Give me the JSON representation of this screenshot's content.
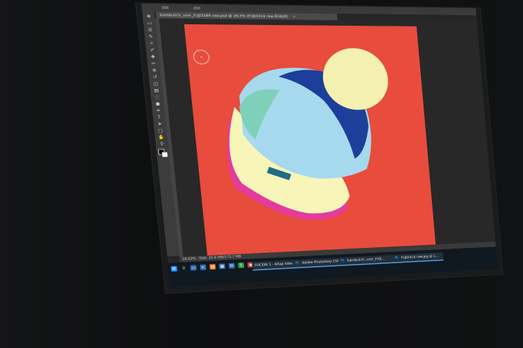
{
  "photoshop": {
    "document_tab": "bambulich_vzor_FUJI3189 raw.psd @ 26,5% (FUJI0419 raw,RGB/8)",
    "tab_close": "×",
    "ruler_top": [
      "300",
      "200"
    ],
    "status_zoom": "26,52%",
    "status_doc": "Dok: 20,6 MB/272,7 MB",
    "canvas_background_color": "#e84c3d",
    "hat_colors": [
      "#f4f0b0",
      "#a6d9ee",
      "#1d3f9a",
      "#f7f6b8",
      "#e53a9e"
    ]
  },
  "tools": {
    "icons": [
      "move-icon",
      "marquee-icon",
      "lasso-icon",
      "quick-select-icon",
      "crop-icon",
      "eyedropper-icon",
      "healing-icon",
      "brush-icon",
      "stamp-icon",
      "history-brush-icon",
      "eraser-icon",
      "gradient-icon",
      "blur-icon",
      "dodge-icon",
      "pen-icon",
      "type-icon",
      "path-select-icon",
      "shape-icon",
      "hand-icon",
      "zoom-icon"
    ],
    "glyphs": [
      "✥",
      "▭",
      "ʘ",
      "✎",
      "⌗",
      "✐",
      "✚",
      "✏",
      "⊕",
      "↺",
      "◫",
      "▤",
      "◌",
      "●",
      "✒",
      "T",
      "➤",
      "▢",
      "✋",
      "⚲"
    ]
  },
  "taskbar": {
    "icons": [
      "windows-icon",
      "search-icon",
      "taskview-icon",
      "edge-icon",
      "explorer-icon",
      "store-icon",
      "mail-icon",
      "skype-icon",
      "chrome-icon"
    ],
    "tasks": [
      {
        "label": "FOCENI 1 - Altap Sala...",
        "has_ps_icon": false
      },
      {
        "label": "Adobe Photoshop CS6",
        "has_ps_icon": true
      },
      {
        "label": "bambulich_vzor_FUJI...",
        "has_ps_icon": true
      },
      {
        "label": "FUJI0414 raw.jpg @ 1...",
        "has_ps_icon": true
      }
    ]
  }
}
